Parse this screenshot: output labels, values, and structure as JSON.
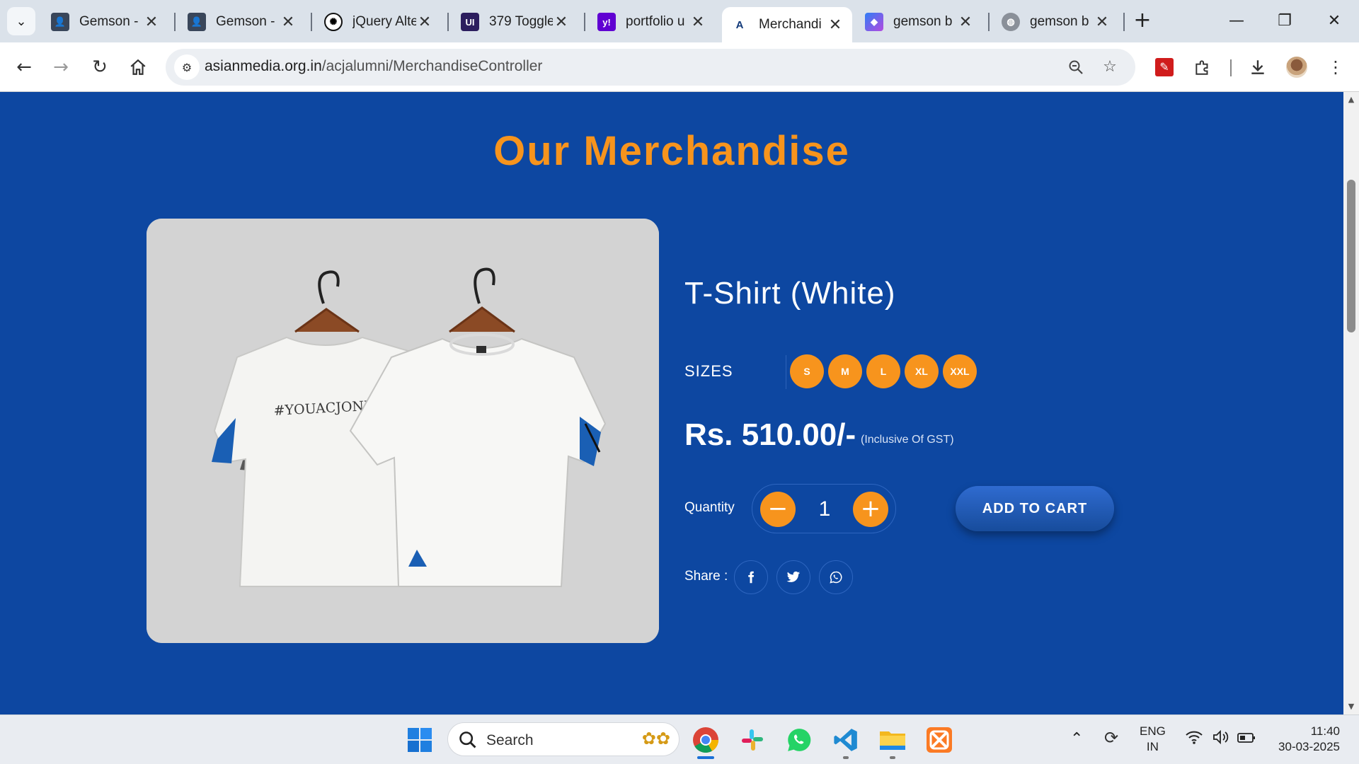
{
  "browser": {
    "tabs": [
      {
        "title": "Gemson - ",
        "favicon": "person-photo"
      },
      {
        "title": "Gemson - ",
        "favicon": "person-photo"
      },
      {
        "title": "jQuery Alte",
        "favicon": "openai-icon"
      },
      {
        "title": "379 Toggle",
        "favicon": "ui-icon"
      },
      {
        "title": "portfolio u",
        "favicon": "yahoo-icon"
      },
      {
        "title": "Merchandi",
        "favicon": "acj-icon",
        "active": true
      },
      {
        "title": "gemson b",
        "favicon": "copilot-icon"
      },
      {
        "title": "gemson b",
        "favicon": "globe-icon"
      }
    ],
    "url_domain": "asianmedia.org.in",
    "url_path": "/acjalumni/MerchandiseController"
  },
  "page": {
    "heading": "Our Merchandise",
    "product": {
      "title": "T-Shirt (White)",
      "sizes_label": "SIZES",
      "sizes": [
        "S",
        "M",
        "L",
        "XL",
        "XXL"
      ],
      "price": "Rs. 510.00/-",
      "price_note": "(Inclusive Of GST)",
      "quantity_label": "Quantity",
      "quantity": "1",
      "add_to_cart": "ADD TO CART",
      "share_label": "Share :",
      "share_icons": [
        "facebook-icon",
        "twitter-icon",
        "whatsapp-icon"
      ],
      "image_text": "#YOUACJONLYONCE"
    },
    "colors": {
      "background": "#0d47a1",
      "accent": "#f7941d",
      "button": "#1e5bb8"
    }
  },
  "taskbar": {
    "search_placeholder": "Search",
    "lang_top": "ENG",
    "lang_bottom": "IN",
    "time": "11:40",
    "date": "30-03-2025"
  }
}
